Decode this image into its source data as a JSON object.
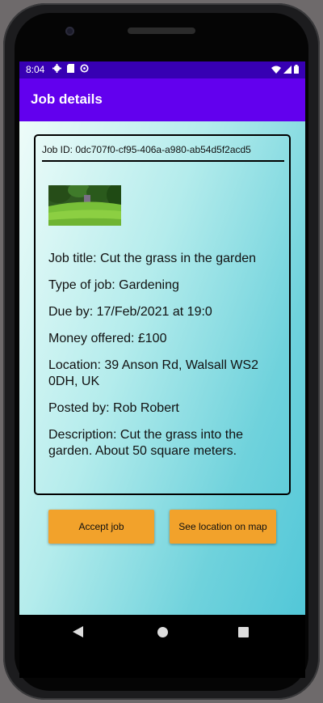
{
  "status_bar": {
    "time": "8:04"
  },
  "app_bar": {
    "title": "Job details"
  },
  "job": {
    "id_text": "Job ID: 0dc707f0-cf95-406a-a980-ab54d5f2acd5",
    "title": "Job title: Cut the grass in the garden",
    "type": "Type of job: Gardening",
    "due": "Due by: 17/Feb/2021 at 19:0",
    "money": "Money offered: £100",
    "location": "Location: 39 Anson Rd, Walsall WS2 0DH, UK",
    "posted_by": "Posted by: Rob Robert",
    "description": "Description: Cut the grass into the garden. About 50 square meters."
  },
  "buttons": {
    "accept": "Accept job",
    "map": "See location on map"
  },
  "colors": {
    "status_bar": "#3700b3",
    "app_bar": "#6200ee",
    "button": "#f2a22b"
  }
}
